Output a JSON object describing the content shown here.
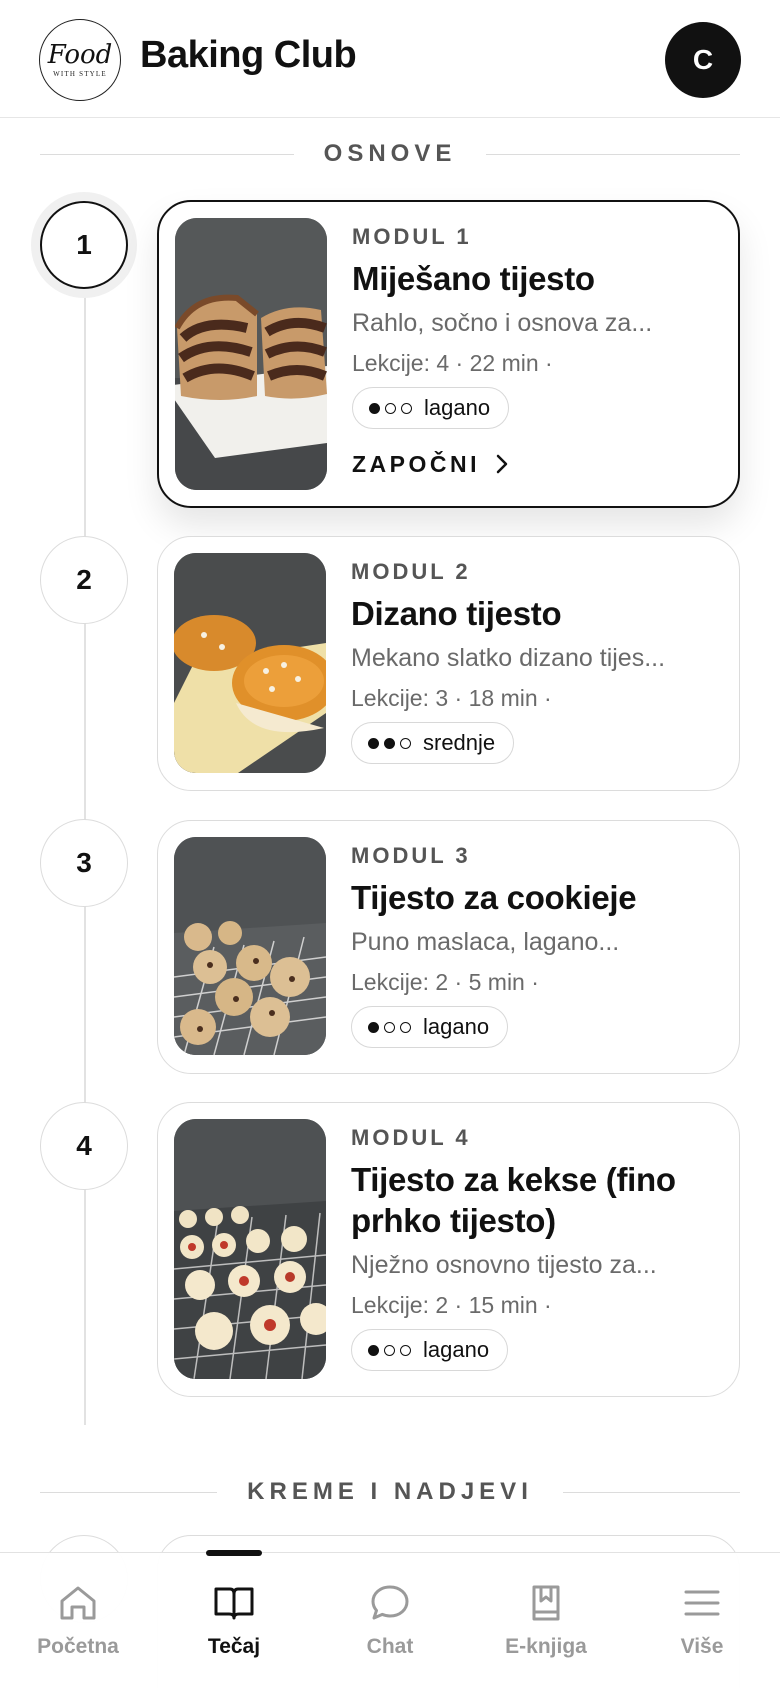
{
  "header": {
    "logo": {
      "script": "Food",
      "sub": "WITH STYLE"
    },
    "title": "Baking Club",
    "avatar_initial": "C"
  },
  "sections": [
    {
      "title": "OSNOVE"
    },
    {
      "title": "KREME I NADJEVI"
    }
  ],
  "modules": [
    {
      "step": "1",
      "label": "MODUL 1",
      "title": "Miješano tijesto",
      "description": "Rahlo, sočno i osnova za...",
      "meta": "Lekcije: 4 · 22 min ·",
      "level": "lagano",
      "level_dots": 1,
      "cta": "ZAPOČNI",
      "active": true,
      "image": "marble-cake"
    },
    {
      "step": "2",
      "label": "MODUL 2",
      "title": "Dizano tijesto",
      "description": "Mekano slatko dizano tijes...",
      "meta": "Lekcije: 3 · 18 min ·",
      "level": "srednje",
      "level_dots": 2,
      "active": false,
      "image": "sweet-bread"
    },
    {
      "step": "3",
      "label": "MODUL 3",
      "title": "Tijesto za cookieje",
      "description": "Puno maslaca, lagano...",
      "meta": "Lekcije: 2 · 5 min ·",
      "level": "lagano",
      "level_dots": 1,
      "active": false,
      "image": "cookies"
    },
    {
      "step": "4",
      "label": "MODUL 4",
      "title": "Tijesto za kekse (fino prhko tijesto)",
      "description": "Nježno osnovno tijesto za...",
      "meta": "Lekcije: 2 · 15 min ·",
      "level": "lagano",
      "level_dots": 1,
      "active": false,
      "image": "jam-biscuits"
    }
  ],
  "nav": {
    "items": [
      {
        "label": "Početna",
        "icon": "home-icon",
        "active": false
      },
      {
        "label": "Tečaj",
        "icon": "book-open-icon",
        "active": true
      },
      {
        "label": "Chat",
        "icon": "chat-bubble-icon",
        "active": false
      },
      {
        "label": "E-knjiga",
        "icon": "bookmark-book-icon",
        "active": false
      },
      {
        "label": "Više",
        "icon": "menu-icon",
        "active": false
      }
    ]
  },
  "colors": {
    "text": "#111111",
    "muted": "#6a6a6a",
    "border": "#dcdcdc",
    "nav_inactive": "#9a9a9a"
  }
}
